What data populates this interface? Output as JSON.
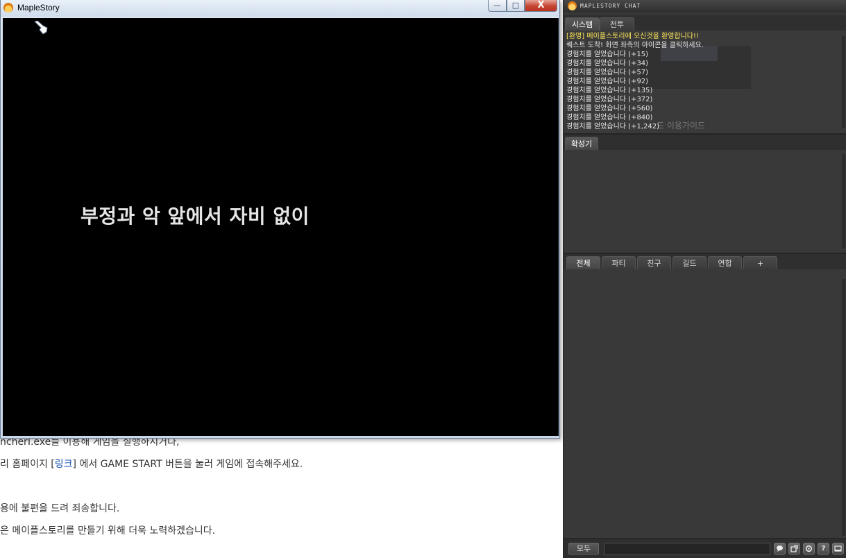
{
  "background_page": {
    "lines": [
      {
        "text": "ncherІ.exe를 이용해 게임을 실행하시거나,"
      },
      {
        "prefix": "리 홈페이지 [",
        "link": "링크",
        "suffix": "] 에서 GAME START 버튼을 눌러 게임에 접속해주세요."
      },
      {
        "text": "용에 불편을 드려 죄송합니다."
      },
      {
        "text": "은 메이플스토리를 만들기 위해 더욱 노력하겠습니다."
      }
    ]
  },
  "game_window": {
    "title": "MapleStory",
    "buttons": {
      "minimize": "—",
      "maximize": "□",
      "close": "X"
    },
    "caption": "부정과 악 앞에서 자비 없이"
  },
  "chat": {
    "title": "MAPLESTORY CHAT",
    "system_tabs": [
      "시스템",
      "전투"
    ],
    "messages": [
      {
        "text": "[환영] 메이플스토리에 오신것을 환영합니다!!",
        "type": "welcome"
      },
      {
        "text": "퀘스트 도착! 화면 좌측의 아이콘을 클릭하세요.",
        "type": "normal"
      },
      {
        "text": "경험치를 얻었습니다 (+15)",
        "type": "normal"
      },
      {
        "text": "경험치를 얻었습니다 (+34)",
        "type": "normal"
      },
      {
        "text": "경험치를 얻었습니다 (+57)",
        "type": "normal"
      },
      {
        "text": "경험치를 얻었습니다 (+92)",
        "type": "normal"
      },
      {
        "text": "경험치를 얻었습니다 (+135)",
        "type": "normal"
      },
      {
        "text": "경험치를 얻었습니다 (+372)",
        "type": "normal"
      },
      {
        "text": "경험치를 얻었습니다 (+560)",
        "type": "normal"
      },
      {
        "text": "경험치를 얻었습니다 (+840)",
        "type": "normal"
      },
      {
        "text": "경험치를 얻었습니다 (+1,242)",
        "type": "normal"
      }
    ],
    "ghost_text": "드 이용가이드",
    "megaphone_tab": "확성기",
    "chat_tabs": [
      "전체",
      "파티",
      "친구",
      "길드",
      "연합",
      "+"
    ],
    "bottom": {
      "all_button": "모두",
      "input_value": "",
      "icons": [
        "speech-icon",
        "popout-icon",
        "settings-icon",
        "help-icon",
        "minimize-panel-icon"
      ],
      "help_label": "?"
    }
  },
  "colors": {
    "welcome_message": "#ffe85a",
    "chat_background": "#383838",
    "game_screen": "#000000",
    "close_button": "#c54530"
  }
}
